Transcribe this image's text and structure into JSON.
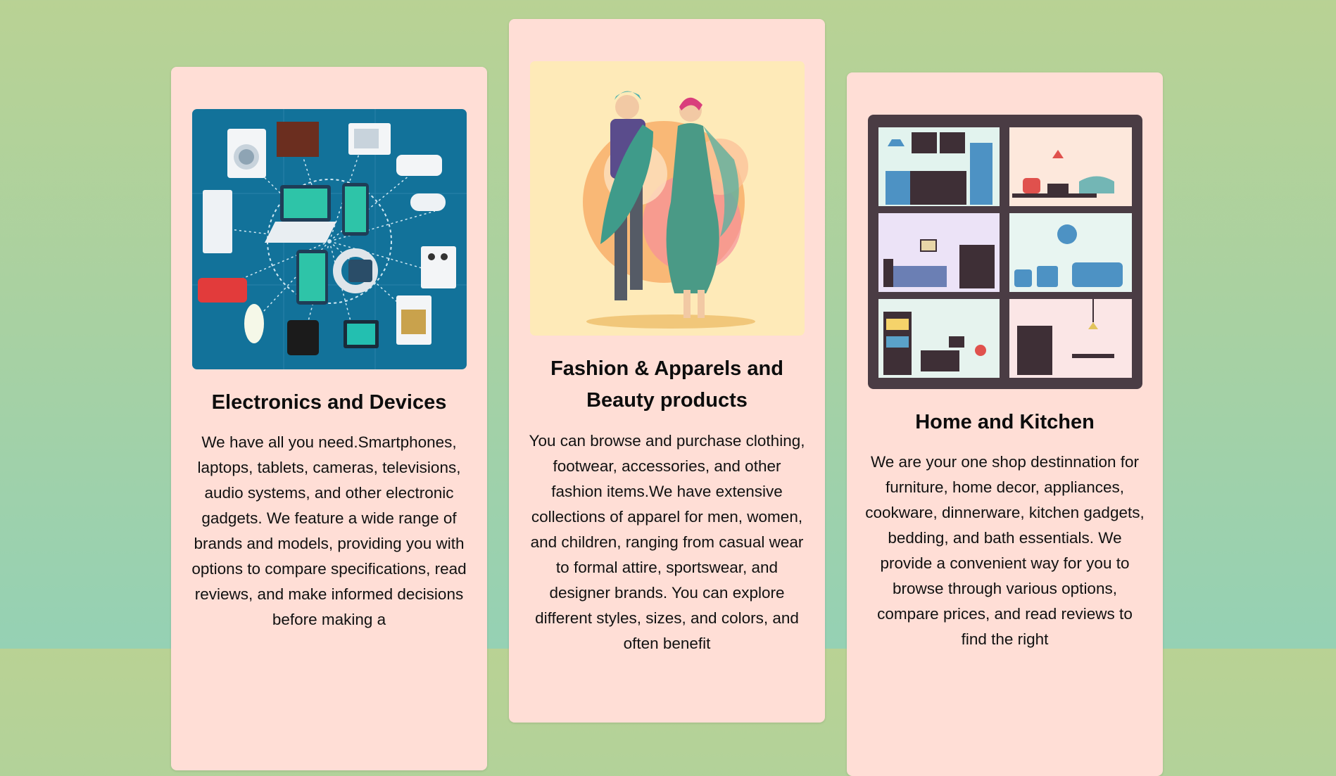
{
  "cards": [
    {
      "title": "Electronics and Devices",
      "image_icon": "electronics-illustration",
      "text": "We have all you need.Smartphones, laptops, tablets, cameras, televisions, audio systems, and other electronic gadgets. We feature a wide range of brands and models, providing you with options to compare specifications, read reviews, and make informed decisions before making a"
    },
    {
      "title": "Fashion & Apparels and Beauty products",
      "image_icon": "fashion-couple-illustration",
      "text": "You can browse and purchase clothing, footwear, accessories, and other fashion items.We have extensive collections of apparel for men, women, and children, ranging from casual wear to formal attire, sportswear, and designer brands. You can explore different styles, sizes, and colors, and often benefit"
    },
    {
      "title": "Home and Kitchen",
      "image_icon": "house-rooms-illustration",
      "text": "We are your one shop destinnation for furniture, home decor, appliances, cookware, dinnerware, kitchen gadgets, bedding, and bath essentials. We provide a convenient way for you to browse through various options, compare prices, and read reviews to find the right"
    }
  ],
  "colors": {
    "card_background": "#ffded6",
    "electronics_bg": "#12729a",
    "fashion_bg": "#feeab8",
    "house_frame": "#4a3c44"
  }
}
